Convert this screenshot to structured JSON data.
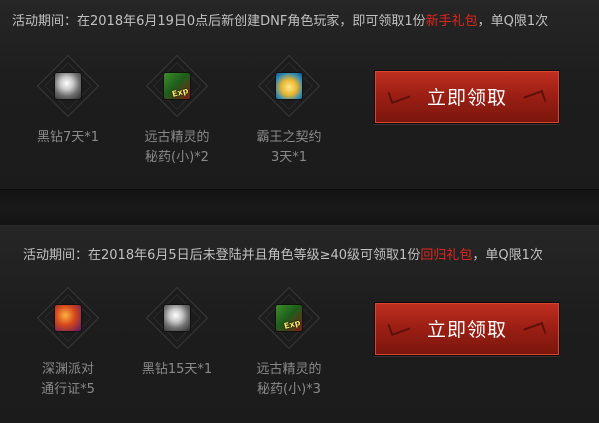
{
  "sections": [
    {
      "headline_prefix": "活动期间：在2018年6月19日0点后新创建DNF角色玩家，即可领取1份",
      "headline_highlight": "新手礼包",
      "headline_suffix": "，单Q限1次",
      "items": [
        {
          "icon": "black-diamond-icon",
          "label_line1": "黑钻7天*1",
          "label_line2": ""
        },
        {
          "icon": "ancient-potion-icon",
          "label_line1": "远古精灵的",
          "label_line2": "秘药(小)*2"
        },
        {
          "icon": "overlord-pact-icon",
          "label_line1": "霸王之契约",
          "label_line2": "3天*1"
        }
      ],
      "button_label": "立即领取"
    },
    {
      "headline_prefix": "活动期间：在2018年6月5日后未登陆并且角色等级≥40级可领取1份",
      "headline_highlight": "回归礼包",
      "headline_suffix": "，单Q限1次",
      "items": [
        {
          "icon": "abyss-pass-icon",
          "label_line1": "深渊派对",
          "label_line2": "通行证*5"
        },
        {
          "icon": "black-diamond-icon",
          "label_line1": "黑钻15天*1",
          "label_line2": ""
        },
        {
          "icon": "ancient-potion-icon",
          "label_line1": "远古精灵的",
          "label_line2": "秘药(小)*3"
        }
      ],
      "button_label": "立即领取"
    }
  ],
  "icon_text": {
    "exp": "Exp"
  },
  "colors": {
    "highlight": "#e2261e",
    "button": "#a62416",
    "background": "#1a1a1a"
  }
}
